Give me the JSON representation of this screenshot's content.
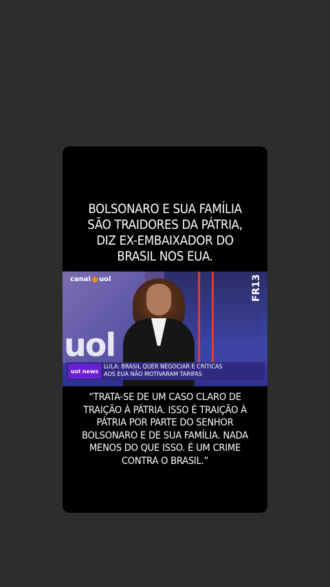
{
  "post": {
    "headline": "BOLSONARO E SUA FAMÍLIA\nSÃO TRAIDORES  DA PÁTRIA,\nDIZ EX-EMBAIXADOR DO\nBRASIL NOS EUA.",
    "quote": "“TRATA-SE DE UM CASO CLARO DE\nTRAIÇÃO À PÁTRIA. ISSO É TRAIÇÃO À\nPÁTRIA POR PARTE DO SENHOR\nBOLSONARO E DE SUA FAMÍLIA. NADA\nMENOS DO QUE ISSO. É UM CRIME\nCONTRA O BRASIL.”"
  },
  "video": {
    "channel_logo_left": "canal",
    "channel_logo_right": "uol",
    "studio_watermark": "uol",
    "tag": "FR13",
    "news_badge": "uol news",
    "lower_third": "LULA: BRASIL QUER NEGOCIAR E CRÍTICAS\nAOS EUA NÃO MOTIVARAM TARIFAS"
  },
  "colors": {
    "page_background": "#2d2d2d",
    "card_background": "#000000",
    "accent_orange": "#f28a1a",
    "badge_purple": "#6b1fd1",
    "lower_third_blue": "#2f2a80"
  }
}
